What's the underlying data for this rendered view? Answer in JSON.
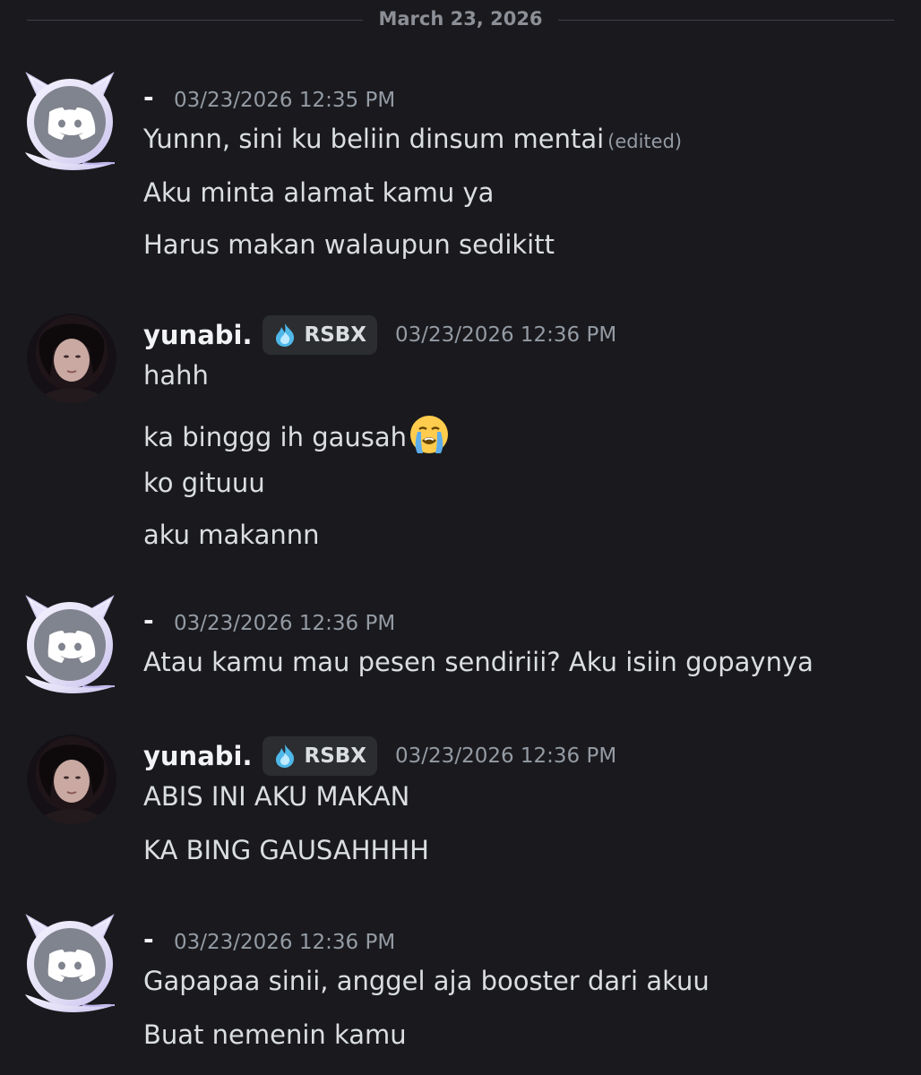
{
  "date_divider": "March 23, 2026",
  "messages": [
    {
      "username": "-",
      "timestamp": "03/23/2026 12:35 PM",
      "lines": [
        "Yunnn, sini ku beliin dinsum mentai",
        "Aku minta alamat kamu ya",
        "Harus makan walaupun sedikitt"
      ],
      "edited": "(edited)"
    },
    {
      "username": "yunabi.",
      "tag": "RSBX",
      "timestamp": "03/23/2026 12:36 PM",
      "lines": [
        "hahh",
        "ka binggg ih gausah",
        "ko gituuu",
        "aku makannn"
      ]
    },
    {
      "username": "-",
      "timestamp": "03/23/2026 12:36 PM",
      "lines": [
        "Atau kamu mau pesen sendiriii? Aku isiin gopaynya"
      ]
    },
    {
      "username": "yunabi.",
      "tag": "RSBX",
      "timestamp": "03/23/2026 12:36 PM",
      "lines": [
        "ABIS INI AKU MAKAN",
        "KA BING GAUSAHHHH"
      ]
    },
    {
      "username": "-",
      "timestamp": "03/23/2026 12:36 PM",
      "lines": [
        "Gapapaa sinii, anggel aja booster dari akuu",
        "Buat nemenin kamu"
      ]
    }
  ],
  "colors": {
    "background": "#1a1a1e",
    "text": "#dbdee1",
    "muted": "#949ba4",
    "tag_bg": "#2b2d31",
    "default_avatar": "#80848e"
  },
  "icons": {
    "default_avatar": "discord-logo-icon",
    "avatar_decoration": "cat-ear-frame-icon",
    "tag": "blue-flame-icon",
    "emoji": "loudly-crying-face-icon"
  }
}
